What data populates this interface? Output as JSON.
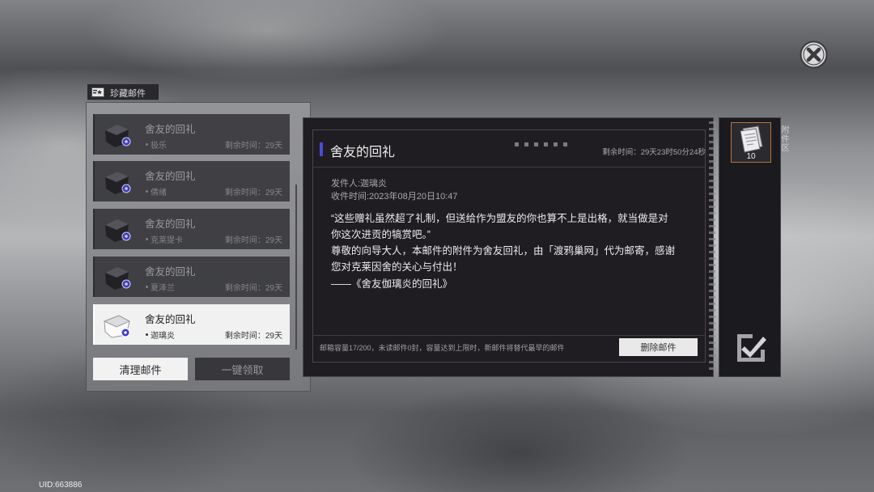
{
  "theme": {
    "accent_color": "#4a4ad8",
    "badge_color": "#3b3bd0",
    "attachment_border_color": "#b7743c"
  },
  "window": {
    "close_icon": "close-icon"
  },
  "tab": {
    "label": "珍藏邮件",
    "icon": "mail-tab-icon"
  },
  "mail_list": {
    "items": [
      {
        "subject": "舍友的回礼",
        "sender": "极乐",
        "remaining": "剩余时间：29天",
        "selected": false
      },
      {
        "subject": "舍友的回礼",
        "sender": "倩绪",
        "remaining": "剩余时间：29天",
        "selected": false
      },
      {
        "subject": "舍友的回礼",
        "sender": "克莱提卡",
        "remaining": "剩余时间：29天",
        "selected": false
      },
      {
        "subject": "舍友的回礼",
        "sender": "夏泽兰",
        "remaining": "剩余时间：29天",
        "selected": false
      },
      {
        "subject": "舍友的回礼",
        "sender": "迦璃炎",
        "remaining": "剩余时间：29天",
        "selected": true
      }
    ]
  },
  "actions": {
    "clear_label": "清理邮件",
    "claim_all_label": "一键领取"
  },
  "mail_detail": {
    "title": "舍友的回礼",
    "remaining_time": "剩余时间：29天23时50分24秒",
    "sender": "发件人:迦璃炎",
    "received_time": "收件时间:2023年08月20日10:47",
    "body_lines": [
      "“这些赠礼虽然超了礼制，但送给作为盟友的你也算不上是出格，就当做是对",
      "你这次进贡的犒赏吧。”",
      "尊敬的向导大人，本邮件的附件为舍友回礼，由「渡鸦巢网」代为邮寄，感谢",
      "您对克莱因舍的关心与付出！",
      "——《舍友伽璃炎的回礼》"
    ],
    "footer_info": "邮箱容量17/200，未读邮件0封，容量达到上限时，新邮件将替代最早的邮件",
    "delete_label": "删除邮件"
  },
  "attachments": {
    "label": "附件区",
    "items": [
      {
        "icon": "paper-item-icon",
        "count": "10"
      }
    ],
    "claim_icon": "check-icon"
  },
  "uid": "UID:663886"
}
